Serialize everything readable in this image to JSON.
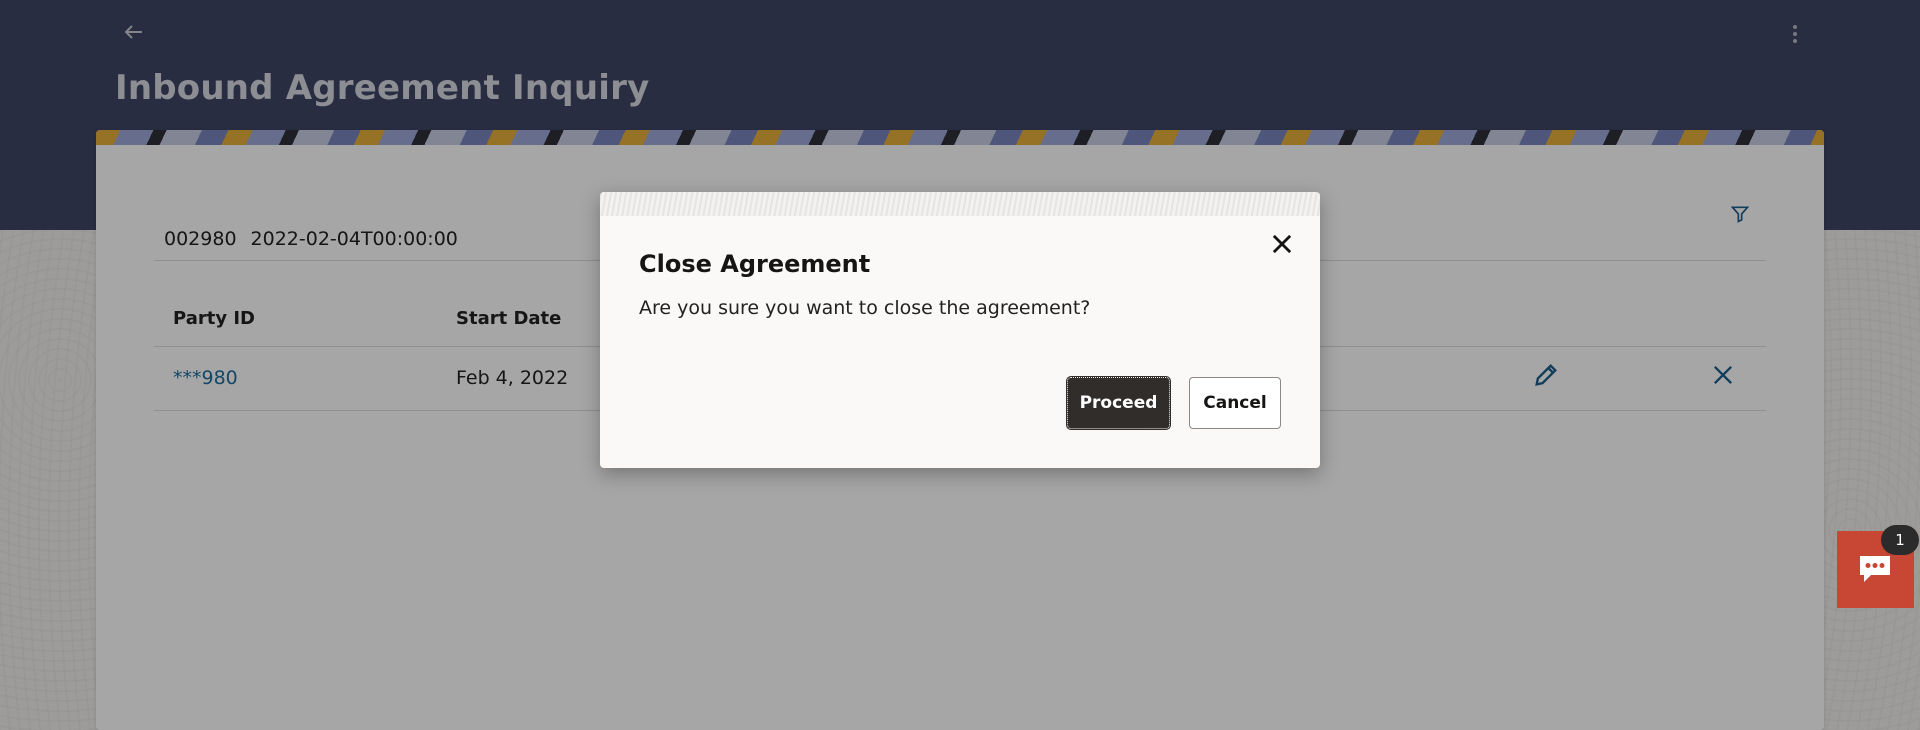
{
  "header": {
    "title": "Inbound Agreement Inquiry",
    "back_icon": "arrow-left-icon",
    "menu_icon": "kebab-menu-icon"
  },
  "summary": {
    "party_id": "002980",
    "date": "2022-02-04T00:00:00"
  },
  "table": {
    "columns": [
      "Party ID",
      "Start Date"
    ],
    "rows": [
      {
        "party_id": "***980",
        "start_date": "Feb 4, 2022"
      }
    ]
  },
  "modal": {
    "title": "Close Agreement",
    "message": "Are you sure you want to close the agreement?",
    "proceed_label": "Proceed",
    "cancel_label": "Cancel"
  },
  "chat": {
    "badge_count": "1"
  },
  "colors": {
    "header": "#3e4565",
    "link": "#1f6e9e",
    "primary_button": "#312d2a",
    "chat_fab": "#c74634"
  }
}
